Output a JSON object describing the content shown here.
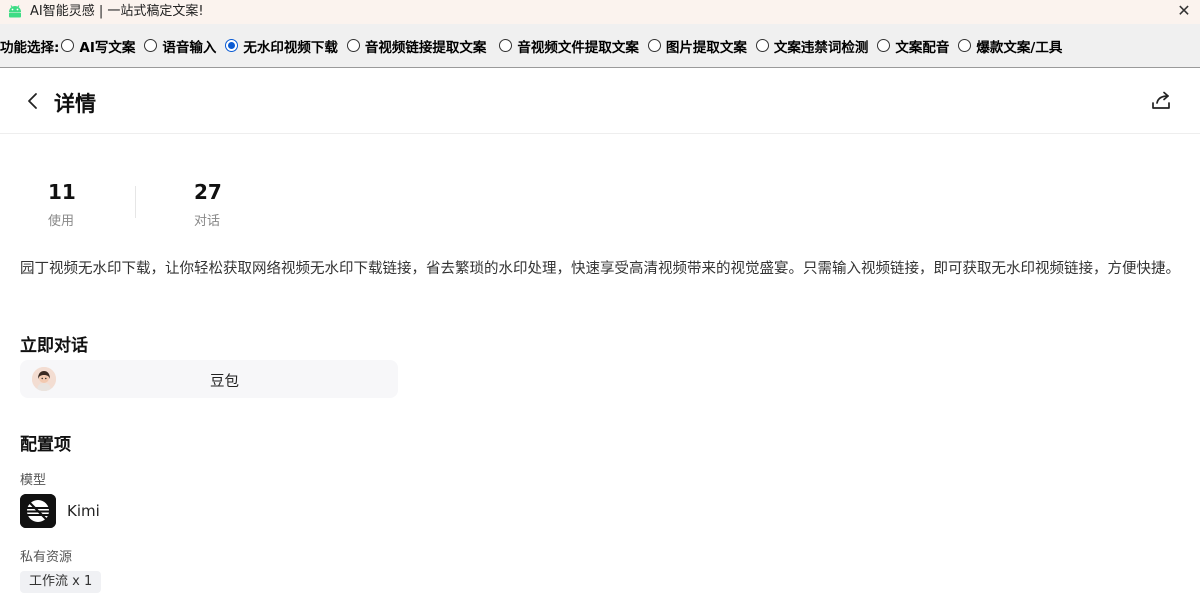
{
  "window": {
    "title": "AI智能灵感 | 一站式稿定文案!",
    "close_symbol": "✕",
    "icon": "android-icon",
    "accent": "#3ddc84"
  },
  "function_bar": {
    "label": "功能选择:",
    "options": [
      {
        "label": "AI写文案",
        "selected": false
      },
      {
        "label": "语音输入",
        "selected": false
      },
      {
        "label": "无水印视频下载",
        "selected": true
      },
      {
        "label": "音视频链接提取文案",
        "selected": false
      },
      {
        "label": "音视频文件提取文案",
        "selected": false
      },
      {
        "label": "图片提取文案",
        "selected": false
      },
      {
        "label": "文案违禁词检测",
        "selected": false
      },
      {
        "label": "文案配音",
        "selected": false
      },
      {
        "label": "爆款文案/工具",
        "selected": false
      }
    ],
    "selected_color": "#0a5bd3"
  },
  "header": {
    "title": "详情",
    "back_icon": "chevron-left-icon",
    "share_icon": "share-icon"
  },
  "stats": [
    {
      "value": "11",
      "label": "使用"
    },
    {
      "value": "27",
      "label": "对话"
    }
  ],
  "description": "园丁视频无水印下载，让你轻松获取网络视频无水印下载链接，省去繁琐的水印处理，快速享受高清视频带来的视觉盛宴。只需输入视频链接，即可获取无水印视频链接，方便快捷。",
  "chat_section": {
    "title": "立即对话",
    "bot_name": "豆包"
  },
  "config_section": {
    "title": "配置项",
    "model_label": "模型",
    "model_name": "Kimi",
    "resources_label": "私有资源",
    "resource_tag": "工作流 x 1"
  }
}
